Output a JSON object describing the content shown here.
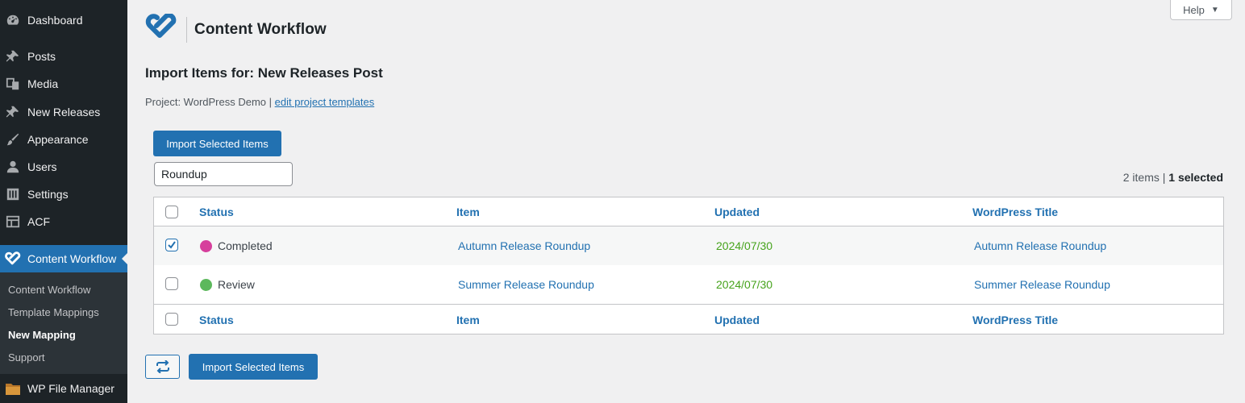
{
  "sidebar": {
    "items": [
      {
        "label": "Dashboard",
        "icon": "dashboard-icon"
      },
      {
        "label": "Posts",
        "icon": "pin-icon"
      },
      {
        "label": "Media",
        "icon": "media-icon"
      },
      {
        "label": "New Releases",
        "icon": "pin-icon"
      },
      {
        "label": "Appearance",
        "icon": "brush-icon"
      },
      {
        "label": "Users",
        "icon": "user-icon"
      },
      {
        "label": "Settings",
        "icon": "settings-icon"
      },
      {
        "label": "ACF",
        "icon": "grid-icon"
      },
      {
        "label": "Content Workflow",
        "icon": "content-workflow-icon"
      },
      {
        "label": "WP File Manager",
        "icon": "folder-icon"
      }
    ],
    "submenu": [
      "Content Workflow",
      "Template Mappings",
      "New Mapping",
      "Support"
    ]
  },
  "help": {
    "label": "Help"
  },
  "brand": {
    "title": "Content Workflow",
    "color": "#2271b1"
  },
  "page": {
    "heading": "Import Items for: New Releases Post",
    "project_prefix": "Project: WordPress Demo | ",
    "project_link": "edit project templates"
  },
  "toolbar": {
    "import_label": "Import Selected Items",
    "search_value": "Roundup",
    "count_text": "2 items | ",
    "selected_text": "1 selected"
  },
  "table": {
    "columns": [
      "Status",
      "Item",
      "Updated",
      "WordPress Title"
    ],
    "rows": [
      {
        "checked": true,
        "status": "Completed",
        "status_color": "#d63f9c",
        "item": "Autumn Release Roundup",
        "updated": "2024/07/30",
        "wp_title": "Autumn Release Roundup"
      },
      {
        "checked": false,
        "status": "Review",
        "status_color": "#5cb85c",
        "item": "Summer Release Roundup",
        "updated": "2024/07/30",
        "wp_title": "Summer Release Roundup"
      }
    ]
  },
  "footer": {
    "import_label": "Import Selected Items",
    "refresh_icon": "refresh-icon"
  }
}
